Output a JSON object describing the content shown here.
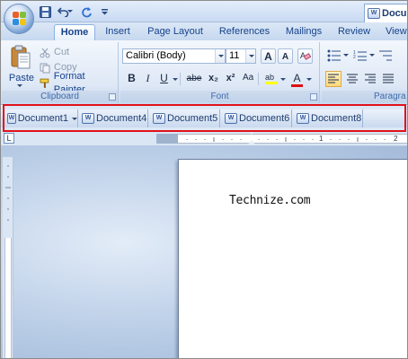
{
  "tabs": [
    "Home",
    "Insert",
    "Page Layout",
    "References",
    "Mailings",
    "Review",
    "View"
  ],
  "clipboard": {
    "paste_label": "Paste",
    "cut_label": "Cut",
    "copy_label": "Copy",
    "format_painter_label": "Format Painter",
    "group_label": "Clipboard"
  },
  "font": {
    "font_name": "Calibri (Body)",
    "font_size": "11",
    "group_label": "Font",
    "bold": "B",
    "italic": "I",
    "underline": "U",
    "strike": "abe",
    "subscript": "x₂",
    "superscript": "x²",
    "grow": "A",
    "shrink": "A",
    "color": "A"
  },
  "paragraph": {
    "group_label": "Paragra"
  },
  "document_tabs": [
    "Document1",
    "Document4",
    "Document5",
    "Document6",
    "Document8",
    "Docu"
  ],
  "ruler": {
    "tab_selector": "L",
    "numbers": [
      "1",
      "2"
    ]
  },
  "page": {
    "text": "Technize.com"
  },
  "colors": {
    "highlight_border": "#e0111b",
    "accent": "#15428b",
    "text_highlight": "#ffff00",
    "font_color": "#e01010"
  }
}
